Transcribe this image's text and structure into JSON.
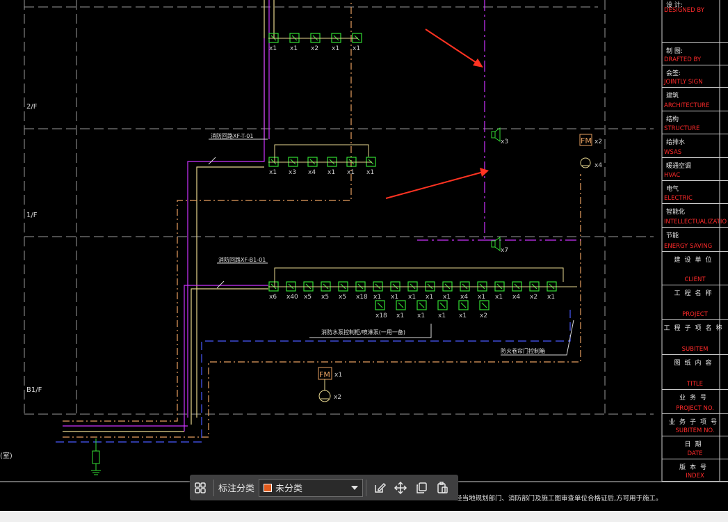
{
  "floors": {
    "f2": "2/F",
    "f1": "1/F",
    "b1": "B1/F"
  },
  "circuit_labels": {
    "upper": "消防回路XF-T-01",
    "lower": "消防回路XF-B1-01"
  },
  "notes": {
    "pump": "消防水泵控制柜/喷淋泵(一用一备)",
    "fire_door": "防火卷帘门控制箱",
    "footer": "经当地规划部门、消防部门及施工图审查单位合格证后,方可用于施工。",
    "left_edge": "(室)"
  },
  "device_labels": {
    "fm_top": "FM",
    "x2": "x2",
    "x4": "x4",
    "x3": "x3",
    "x7": "x7",
    "fm_bottom": "FM",
    "x1": "x1"
  },
  "title_block": [
    {
      "cn": "设 计:",
      "en": "DESIGNED BY"
    },
    {
      "cn": "制 图:",
      "en": "DRAFTED BY"
    },
    {
      "cn": "会签:",
      "en": "JOINTLY SIGN"
    },
    {
      "cn": "建筑",
      "en": "ARCHITECTURE"
    },
    {
      "cn": "结构",
      "en": "STRUCTURE"
    },
    {
      "cn": "给排水",
      "en": "WSAS"
    },
    {
      "cn": "暖通空调",
      "en": "HVAC"
    },
    {
      "cn": "电气",
      "en": "ELECTRIC"
    },
    {
      "cn": "智能化",
      "en": "INTELLECTUALIZATIO"
    },
    {
      "cn": "节能",
      "en": "ENERGY SAVING"
    },
    {
      "cn": "建设单位",
      "en": "CLIENT"
    },
    {
      "cn": "工程名称",
      "en": "PROJECT"
    },
    {
      "cn": "工程子项名称",
      "en": "SUBITEM"
    },
    {
      "cn": "图纸内容",
      "en": "TITLE"
    },
    {
      "cn": "业务号",
      "en": "PROJECT NO."
    },
    {
      "cn": "业务子项号",
      "en": "SUBITEM NO."
    },
    {
      "cn": "日期",
      "en": "DATE"
    },
    {
      "cn": "版本号",
      "en": "INDEX"
    }
  ],
  "toolbar": {
    "label": "标注分类",
    "selected_category": "未分类",
    "selected_color": "#e05a1c",
    "icons": [
      "grid-icon",
      "edit-icon",
      "move-icon",
      "copy-icon",
      "paste-icon"
    ]
  },
  "colors": {
    "line_yellow": "#e8d890",
    "line_magenta": "#cc33ff",
    "line_orange": "#e8a060",
    "device_green": "#33dd33",
    "annotation_red": "#ff3322",
    "title_red": "#ff2a2a"
  }
}
